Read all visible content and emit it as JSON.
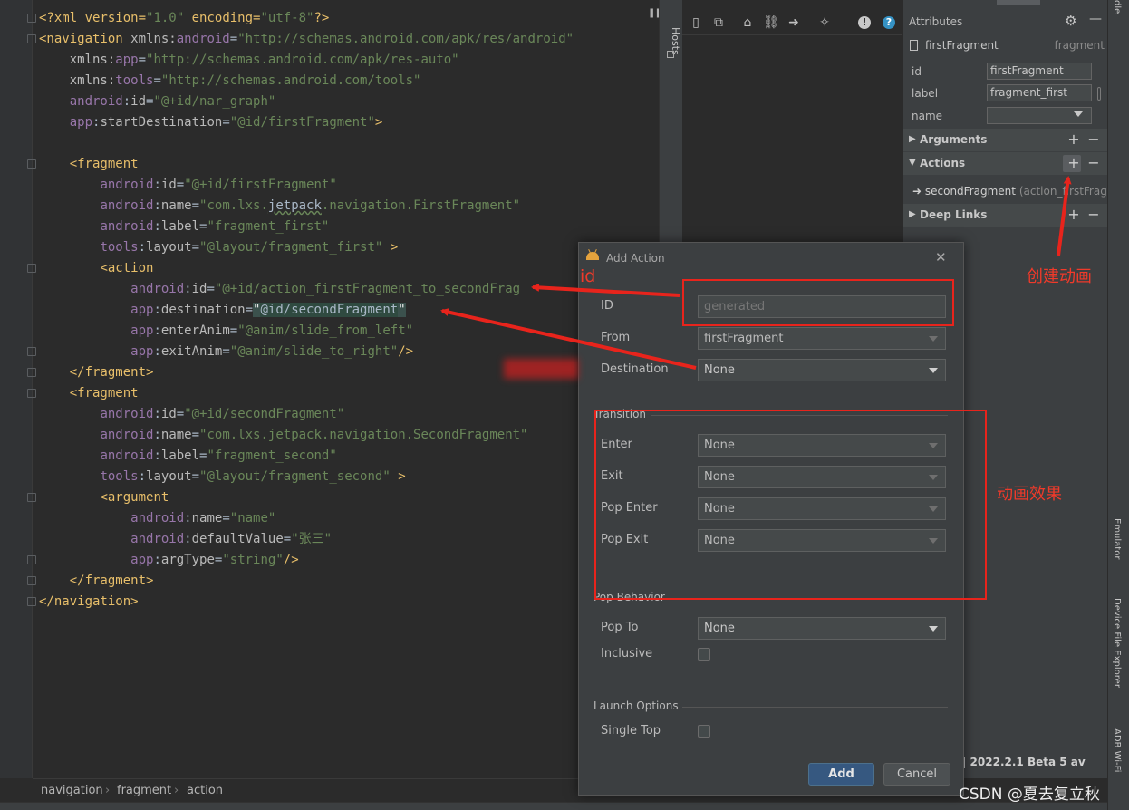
{
  "editor": {
    "lines": [
      {
        "parts": [
          [
            "tag",
            "<?xml version="
          ],
          [
            "val",
            "\"1.0\""
          ],
          [
            "tag",
            " encoding="
          ],
          [
            "val",
            "\"utf-8\""
          ],
          [
            "tag",
            "?>"
          ]
        ]
      },
      {
        "parts": [
          [
            "tag",
            "<navigation "
          ],
          [
            "attr",
            "xmlns:"
          ],
          [
            "ns",
            "android"
          ],
          [
            "pl",
            "="
          ],
          [
            "val",
            "\"http://schemas.android.com/apk/res/android\""
          ]
        ]
      },
      {
        "parts": [
          [
            "pl",
            "    "
          ],
          [
            "attr",
            "xmlns:"
          ],
          [
            "ns",
            "app"
          ],
          [
            "pl",
            "="
          ],
          [
            "val",
            "\"http://schemas.android.com/apk/res-auto\""
          ]
        ]
      },
      {
        "parts": [
          [
            "pl",
            "    "
          ],
          [
            "attr",
            "xmlns:"
          ],
          [
            "ns",
            "tools"
          ],
          [
            "pl",
            "="
          ],
          [
            "val",
            "\"http://schemas.android.com/tools\""
          ]
        ]
      },
      {
        "parts": [
          [
            "pl",
            "    "
          ],
          [
            "ns",
            "android"
          ],
          [
            "pl",
            ":"
          ],
          [
            "attr",
            "id"
          ],
          [
            "pl",
            "="
          ],
          [
            "val",
            "\"@+id/nar_graph\""
          ]
        ]
      },
      {
        "parts": [
          [
            "pl",
            "    "
          ],
          [
            "ns",
            "app"
          ],
          [
            "pl",
            ":"
          ],
          [
            "attr",
            "startDestination"
          ],
          [
            "pl",
            "="
          ],
          [
            "val",
            "\"@id/firstFragment\""
          ],
          [
            "tag",
            ">"
          ]
        ]
      },
      {
        "parts": [
          [
            "pl",
            ""
          ]
        ]
      },
      {
        "parts": [
          [
            "pl",
            "    "
          ],
          [
            "tag",
            "<fragment"
          ]
        ]
      },
      {
        "parts": [
          [
            "pl",
            "        "
          ],
          [
            "ns",
            "android"
          ],
          [
            "pl",
            ":"
          ],
          [
            "attr",
            "id"
          ],
          [
            "pl",
            "="
          ],
          [
            "val",
            "\"@+id/firstFragment\""
          ]
        ]
      },
      {
        "parts": [
          [
            "pl",
            "        "
          ],
          [
            "ns",
            "android"
          ],
          [
            "pl",
            ":"
          ],
          [
            "attr",
            "name"
          ],
          [
            "pl",
            "="
          ],
          [
            "val",
            "\"com.lxs."
          ],
          [
            "sq",
            "jetpack"
          ],
          [
            "val",
            ".navigation.FirstFragment\""
          ]
        ]
      },
      {
        "parts": [
          [
            "pl",
            "        "
          ],
          [
            "ns",
            "android"
          ],
          [
            "pl",
            ":"
          ],
          [
            "attr",
            "label"
          ],
          [
            "pl",
            "="
          ],
          [
            "val",
            "\"fragment_first\""
          ]
        ]
      },
      {
        "parts": [
          [
            "pl",
            "        "
          ],
          [
            "ns",
            "tools"
          ],
          [
            "pl",
            ":"
          ],
          [
            "attr",
            "layout"
          ],
          [
            "pl",
            "="
          ],
          [
            "val",
            "\"@layout/fragment_first\""
          ],
          [
            "tag",
            " >"
          ]
        ]
      },
      {
        "parts": [
          [
            "pl",
            "        "
          ],
          [
            "tag",
            "<action"
          ]
        ]
      },
      {
        "parts": [
          [
            "pl",
            "            "
          ],
          [
            "ns",
            "android"
          ],
          [
            "pl",
            ":"
          ],
          [
            "attr",
            "id"
          ],
          [
            "pl",
            "="
          ],
          [
            "val",
            "\"@+id/action_firstFragment_to_secondFrag"
          ]
        ]
      },
      {
        "parts": [
          [
            "pl",
            "            "
          ],
          [
            "ns",
            "app"
          ],
          [
            "pl",
            ":"
          ],
          [
            "attr",
            "destination"
          ],
          [
            "pl",
            "="
          ],
          [
            "hl",
            "\""
          ],
          [
            "hlstr",
            "@id/secondFragment"
          ],
          [
            "hl",
            "\""
          ]
        ]
      },
      {
        "parts": [
          [
            "pl",
            "            "
          ],
          [
            "ns",
            "app"
          ],
          [
            "pl",
            ":"
          ],
          [
            "attr",
            "enterAnim"
          ],
          [
            "pl",
            "="
          ],
          [
            "val",
            "\"@anim/slide_from_left\""
          ]
        ]
      },
      {
        "parts": [
          [
            "pl",
            "            "
          ],
          [
            "ns",
            "app"
          ],
          [
            "pl",
            ":"
          ],
          [
            "attr",
            "exitAnim"
          ],
          [
            "pl",
            "="
          ],
          [
            "val",
            "\"@anim/slide_to_right\""
          ],
          [
            "tag",
            "/>"
          ]
        ]
      },
      {
        "parts": [
          [
            "pl",
            "    "
          ],
          [
            "tag",
            "</fragment>"
          ]
        ]
      },
      {
        "parts": [
          [
            "pl",
            "    "
          ],
          [
            "tag",
            "<fragment"
          ]
        ]
      },
      {
        "parts": [
          [
            "pl",
            "        "
          ],
          [
            "ns",
            "android"
          ],
          [
            "pl",
            ":"
          ],
          [
            "attr",
            "id"
          ],
          [
            "pl",
            "="
          ],
          [
            "val",
            "\"@+id/secondFragment\""
          ]
        ]
      },
      {
        "parts": [
          [
            "pl",
            "        "
          ],
          [
            "ns",
            "android"
          ],
          [
            "pl",
            ":"
          ],
          [
            "attr",
            "name"
          ],
          [
            "pl",
            "="
          ],
          [
            "val",
            "\"com.lxs.jetpack.navigation.SecondFragment\""
          ]
        ]
      },
      {
        "parts": [
          [
            "pl",
            "        "
          ],
          [
            "ns",
            "android"
          ],
          [
            "pl",
            ":"
          ],
          [
            "attr",
            "label"
          ],
          [
            "pl",
            "="
          ],
          [
            "val",
            "\"fragment_second\""
          ]
        ]
      },
      {
        "parts": [
          [
            "pl",
            "        "
          ],
          [
            "ns",
            "tools"
          ],
          [
            "pl",
            ":"
          ],
          [
            "attr",
            "layout"
          ],
          [
            "pl",
            "="
          ],
          [
            "val",
            "\"@layout/fragment_second\""
          ],
          [
            "tag",
            " >"
          ]
        ]
      },
      {
        "parts": [
          [
            "pl",
            "        "
          ],
          [
            "tag",
            "<argument"
          ]
        ]
      },
      {
        "parts": [
          [
            "pl",
            "            "
          ],
          [
            "ns",
            "android"
          ],
          [
            "pl",
            ":"
          ],
          [
            "attr",
            "name"
          ],
          [
            "pl",
            "="
          ],
          [
            "val",
            "\"name\""
          ]
        ]
      },
      {
        "parts": [
          [
            "pl",
            "            "
          ],
          [
            "ns",
            "android"
          ],
          [
            "pl",
            ":"
          ],
          [
            "attr",
            "defaultValue"
          ],
          [
            "pl",
            "="
          ],
          [
            "val",
            "\"张三\""
          ]
        ]
      },
      {
        "parts": [
          [
            "pl",
            "            "
          ],
          [
            "ns",
            "app"
          ],
          [
            "pl",
            ":"
          ],
          [
            "attr",
            "argType"
          ],
          [
            "pl",
            "="
          ],
          [
            "val",
            "\"string\""
          ],
          [
            "tag",
            "/>"
          ]
        ]
      },
      {
        "parts": [
          [
            "pl",
            "    "
          ],
          [
            "tag",
            "</fragment>"
          ]
        ]
      },
      {
        "parts": [
          [
            "tag",
            "</navigation>"
          ]
        ]
      }
    ],
    "breadcrumb": [
      "navigation",
      "fragment",
      "action"
    ],
    "breadcrumb_sep": "›"
  },
  "hosts": {
    "label": "Hosts"
  },
  "toolbar": {
    "icons": [
      "new-destination-icon",
      "nested-graph-icon",
      "home-icon",
      "link-icon",
      "arrow-right-icon",
      "auto-arrange-icon",
      "warning-icon",
      "help-icon"
    ],
    "glyphs": [
      "▯",
      "⧉",
      "⌂",
      "⛓",
      "➜",
      "✧",
      "!",
      "?"
    ]
  },
  "attributes": {
    "title": "Attributes",
    "minimize": "—",
    "fragment_name": "firstFragment",
    "fragment_type": "fragment",
    "fields": [
      {
        "label": "id",
        "value": "firstFragment"
      },
      {
        "label": "label",
        "value": "fragment_first"
      },
      {
        "label": "name",
        "value": ""
      }
    ],
    "sections": {
      "arguments": "Arguments",
      "actions": "Actions",
      "deep_links": "Deep Links"
    },
    "plus": "+",
    "minus": "−",
    "action_target": "secondFragment",
    "action_id": "(action_firstFragr"
  },
  "right_tabs": {
    "top": "dle",
    "emulator": "Emulator",
    "device_file_explorer": "Device File Explorer",
    "adb_wifi": "ADB Wi-Fi"
  },
  "dialog": {
    "title": "Add Action",
    "close": "✕",
    "id_label": "ID",
    "id_placeholder": "generated",
    "from_label": "From",
    "from_value": "firstFragment",
    "destination_label": "Destination",
    "destination_value": "None",
    "transition_section": "Transition",
    "enter_label": "Enter",
    "enter_value": "None",
    "exit_label": "Exit",
    "exit_value": "None",
    "pop_enter_label": "Pop Enter",
    "pop_enter_value": "None",
    "pop_exit_label": "Pop Exit",
    "pop_exit_value": "None",
    "pop_behavior_section": "Pop Behavior",
    "pop_to_label": "Pop To",
    "pop_to_value": "None",
    "inclusive_label": "Inclusive",
    "launch_options_section": "Launch Options",
    "single_top_label": "Single Top",
    "add_button": "Add",
    "cancel_button": "Cancel"
  },
  "background_version": "| 2022.2.1 Beta 5 av",
  "annotations": {
    "id_note": "id",
    "create_anim_note": "创建动画",
    "anim_effect_note": "动画效果",
    "color": "#e8241c"
  },
  "watermark": "CSDN @夏去复立秋"
}
